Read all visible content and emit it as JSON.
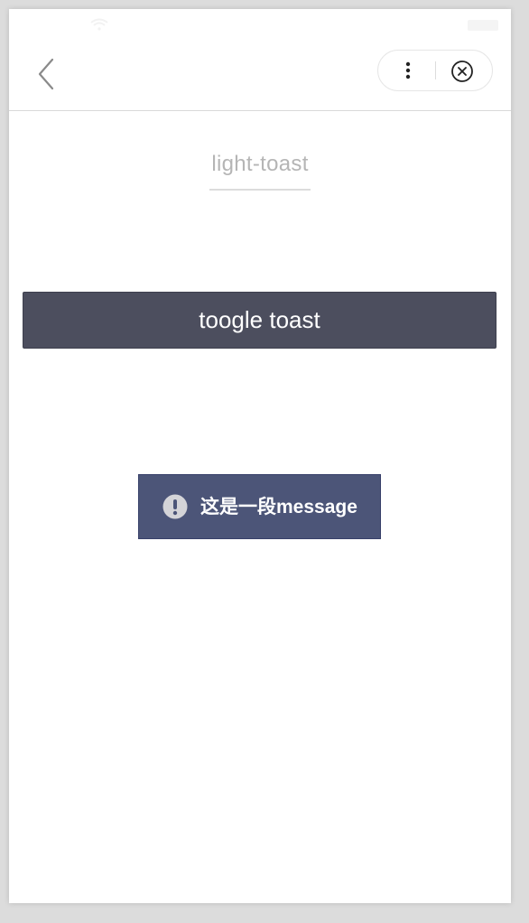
{
  "nav": {
    "back_icon": "chevron-left-icon",
    "more_icon": "more-vertical-icon",
    "close_icon": "close-circle-icon"
  },
  "page": {
    "title": "light-toast"
  },
  "button": {
    "label": "toogle toast"
  },
  "toast": {
    "icon": "exclamation-circle-icon",
    "message": "这是一段message"
  },
  "colors": {
    "button_bg": "#4c4e5e",
    "toast_bg": "#4c5578",
    "title_text": "#b5b5b5"
  }
}
